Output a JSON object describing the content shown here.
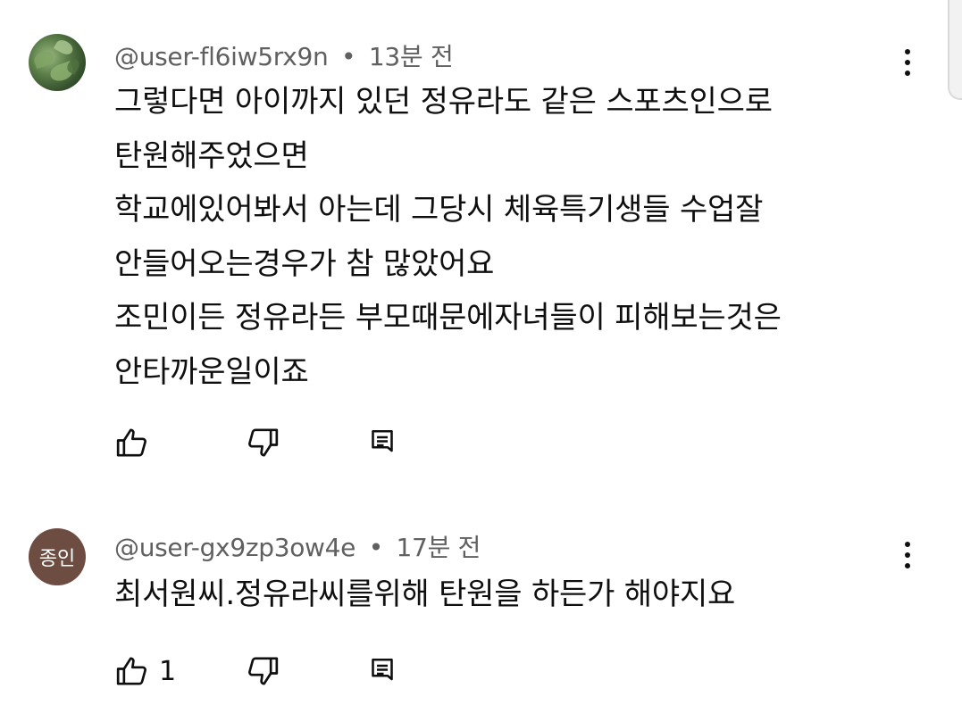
{
  "comments": [
    {
      "author": "@user-fl6iw5rx9n",
      "separator": "•",
      "time": "13분 전",
      "avatar": {
        "type": "photo",
        "description_icon": "leaf-photo-avatar"
      },
      "lines": [
        "그렇다면  아이까지 있던 정유라도 같은 스포츠인으로",
        "탄원해주었으면",
        "학교에있어봐서 아는데 그당시 체육특기생들 수업잘",
        "안들어오는경우가 참 많았어요",
        "조민이든 정유라든 부모때문에자녀들이 피해보는것은",
        "안타까운일이죠"
      ],
      "like_count": ""
    },
    {
      "author": "@user-gx9zp3ow4e",
      "separator": "•",
      "time": "17분 전",
      "avatar": {
        "type": "initials",
        "text": "종인",
        "color": "#6d4c41"
      },
      "lines": [
        "최서원씨.정유라씨를위해 탄원을 하든가 해야지요"
      ],
      "like_count": "1"
    }
  ],
  "icons": {
    "like": "thumbs-up-icon",
    "dislike": "thumbs-down-icon",
    "reply": "reply-comment-icon",
    "menu": "more-vert-icon"
  },
  "colors": {
    "text": "#0f0f0f",
    "meta": "#606060",
    "background": "#ffffff"
  }
}
